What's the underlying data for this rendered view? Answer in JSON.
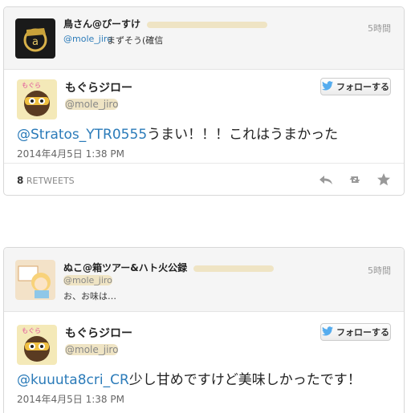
{
  "tweets": [
    {
      "context": {
        "name": "鳥さん@ぴーすけ",
        "screen_name": "@mole_jiro",
        "text": "まずそう(確信",
        "time": "5時間"
      },
      "author": {
        "name": "もぐらジロー",
        "screen_name": "@mole_jiro"
      },
      "follow_label": "フォローする",
      "mention": "@Stratos_YTR0555",
      "text": "うまい！！！これはうまかった",
      "date": "2014年4月5日 1:38 PM",
      "retweet_count": "8",
      "retweet_label": "RETWEETS"
    },
    {
      "context": {
        "name": "ぬこ@箱ツアー&ハト火公録",
        "screen_name": "@mole_jiro",
        "text": "お、お味は…",
        "time": "5時間"
      },
      "author": {
        "name": "もぐらジロー",
        "screen_name": "@mole_jiro"
      },
      "follow_label": "フォローする",
      "mention": "@kuuuta8cri_CR",
      "text": "少し甘めですけど美味しかったです！",
      "date": "2014年4月5日 1:38 PM"
    }
  ],
  "colors": {
    "link": "#2b7bb9",
    "twitter_bird": "#55acee",
    "muted": "#888888",
    "redaction": "#efe4c4"
  },
  "icons": [
    "reply-icon",
    "retweet-icon",
    "favorite-icon",
    "twitter-bird-icon"
  ]
}
